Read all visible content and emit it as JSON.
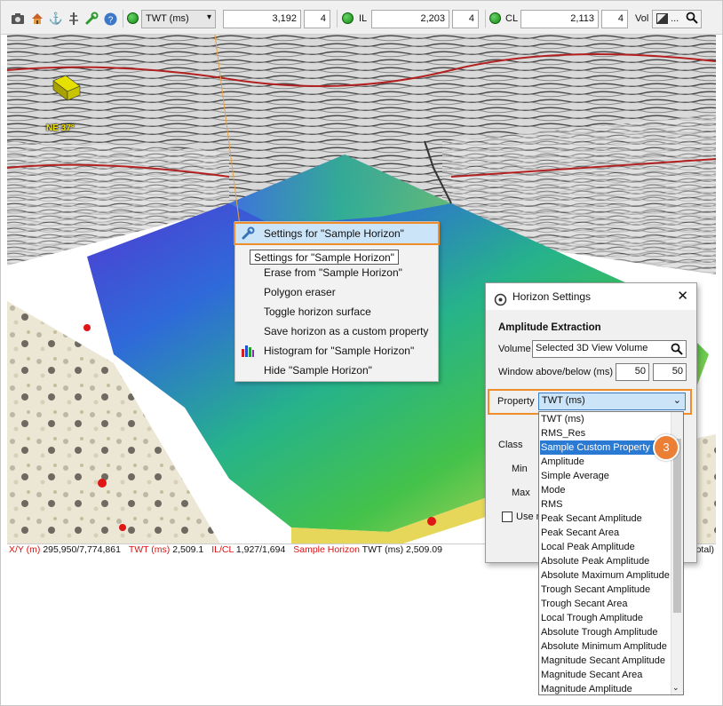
{
  "toolbar": {
    "domain_select": "TWT (ms)",
    "twt_value": "3,192",
    "twt_step": "4",
    "il_label": "IL",
    "il_value": "2,203",
    "il_step": "4",
    "cl_label": "CL",
    "cl_value": "2,113",
    "cl_step": "4",
    "vol_label": "Vol",
    "vol_select": "..."
  },
  "viewport": {
    "compass_text": "NE 37°"
  },
  "context_menu": {
    "items": [
      "Settings for \"Sample Horizon\"",
      "",
      "Erase from \"Sample Horizon\"",
      "Polygon eraser",
      "Toggle horizon surface",
      "Save horizon as a custom property",
      "Histogram for \"Sample Horizon\"",
      "Hide \"Sample Horizon\""
    ],
    "tooltip": "Settings for \"Sample Horizon\""
  },
  "status": {
    "xy_label": "X/Y (m)",
    "xy_value": "295,950/7,774,861",
    "twt_label": "TWT (ms)",
    "twt_value": "2,509.1",
    "ilcl_label": "IL/CL",
    "ilcl_value": "1,927/1,694",
    "horizon_label": "Sample Horizon",
    "horizon_value": "TWT (ms) 2,509.09",
    "trailing": "otal)"
  },
  "dialog": {
    "title": "Horizon Settings",
    "section": "Amplitude Extraction",
    "volume_label": "Volume",
    "volume_value": "Selected 3D View Volume",
    "window_label": "Window above/below (ms)",
    "window_above": "50",
    "window_below": "50",
    "property_label": "Property",
    "property_value": "TWT (ms)",
    "class_label": "Class",
    "min_label": "Min",
    "max_label": "Max",
    "use_label": "Use n"
  },
  "dropdown": {
    "options": [
      "TWT (ms)",
      "RMS_Res",
      "Sample Custom Property",
      "Amplitude",
      "Simple Average",
      "Mode",
      "RMS",
      "Peak Secant Amplitude",
      "Peak Secant Area",
      "Local Peak Amplitude",
      "Absolute Peak Amplitude",
      "Absolute Maximum Amplitude",
      "Trough Secant Amplitude",
      "Trough Secant Area",
      "Local Trough Amplitude",
      "Absolute Trough Amplitude",
      "Absolute Minimum Amplitude",
      "Magnitude Secant Amplitude",
      "Magnitude Secant Area",
      "Magnitude Amplitude"
    ],
    "selected_index": 2
  },
  "badge": "3",
  "colors": {
    "highlight_border": "#f08d2b",
    "selection_blue": "#2a7ad4",
    "status_red": "#d11111",
    "badge_orange": "#ec7f36"
  }
}
